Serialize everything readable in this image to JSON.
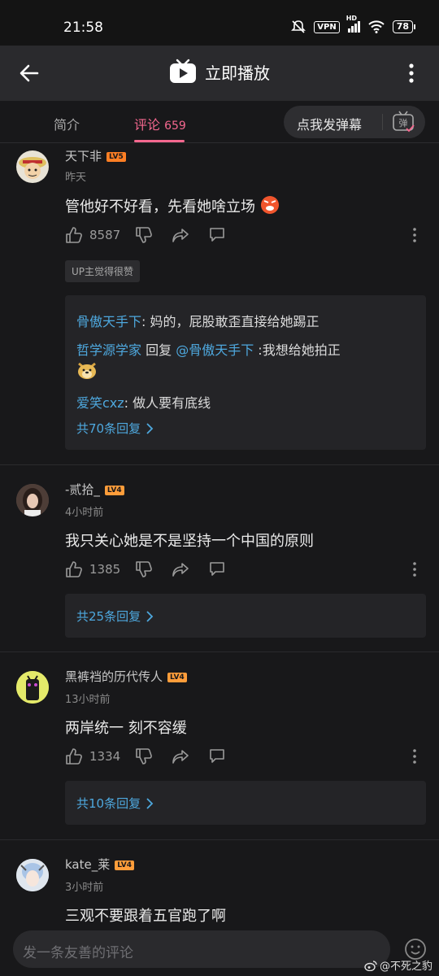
{
  "status": {
    "time": "21:58",
    "vpn": "VPN",
    "network": "HD",
    "battery": "78"
  },
  "header": {
    "title": "立即播放"
  },
  "tabs": {
    "intro": "简介",
    "comments": "评论",
    "comments_count": "659",
    "danmaku_button": "点我发弹幕",
    "danmaku_icon_label": "弹"
  },
  "comments": [
    {
      "user": "天下非",
      "level": "LV5",
      "time": "昨天",
      "text": "管他好不好看，先看她啥立场",
      "likes": "8587",
      "badge": "UP主觉得很赞",
      "replies": [
        {
          "user": "骨傲天手下",
          "text": ": 妈的，屁股敢歪直接给她踢正"
        },
        {
          "user": "哲学源学家",
          "mid": " 回复 ",
          "mention": "@骨傲天手下",
          "text": " :我想给她拍正"
        },
        {
          "user": "爱笑cxz",
          "text": ": 做人要有底线"
        }
      ],
      "more_replies": "共70条回复"
    },
    {
      "user": "-贰拾_",
      "level": "LV4",
      "time": "4小时前",
      "text": "我只关心她是不是坚持一个中国的原则",
      "likes": "1385",
      "more_replies": "共25条回复"
    },
    {
      "user": "黑裤裆的历代传人",
      "level": "LV4",
      "time": "13小时前",
      "text": "两岸统一 刻不容缓",
      "likes": "1334",
      "more_replies": "共10条回复"
    },
    {
      "user": "kate_莱",
      "level": "LV4",
      "time": "3小时前",
      "text": "三观不要跟着五官跑了啊"
    }
  ],
  "input": {
    "placeholder": "发一条友善的评论"
  },
  "watermark": "@不死之豹",
  "colors": {
    "accent": "#f5688f",
    "link": "#4ea8de",
    "background": "#18181a"
  }
}
